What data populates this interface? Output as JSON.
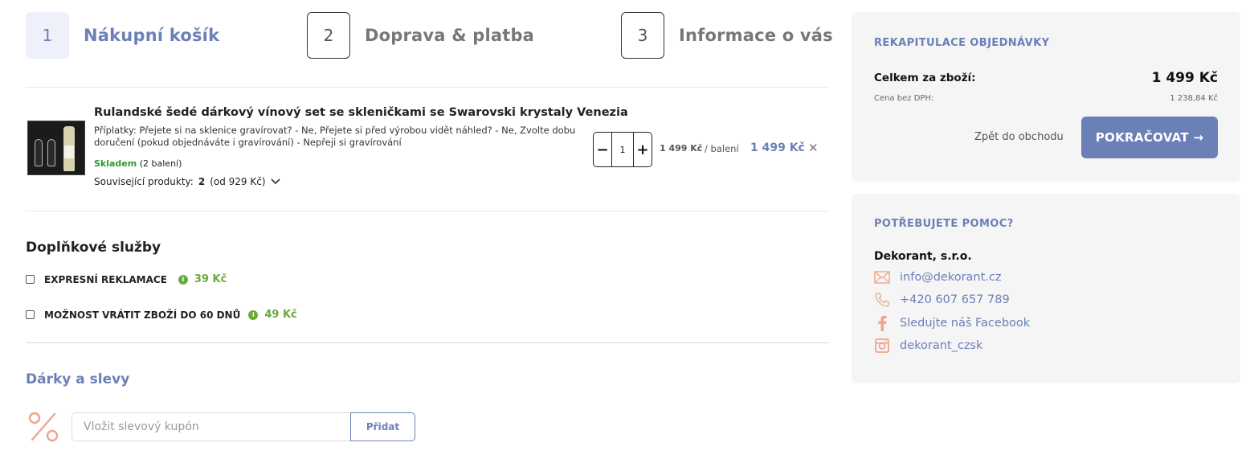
{
  "steps": [
    {
      "num": "1",
      "label": "Nákupní košík"
    },
    {
      "num": "2",
      "label": "Doprava & platba"
    },
    {
      "num": "3",
      "label": "Informace o vás"
    }
  ],
  "product": {
    "title": "Rulandské šedé dárkový vínový set se skleničkami se Swarovski krystaly Venezia",
    "extras": "Příplatky: Přejete si na sklenice gravírovat? - Ne, Přejete si před výrobou vidět náhled? - Ne, Zvolte dobu doručení (pokud objednáváte i gravírování) - Nepřeji si gravírování",
    "stock_status": "Skladem",
    "stock_detail": "(2 balení)",
    "related_label": "Související produkty:",
    "related_count": "2",
    "related_from": "(od 929 Kč)",
    "quantity": "1",
    "unit_price": "1 499 Kč",
    "per_unit": "/ balení",
    "total_price": "1 499 Kč"
  },
  "services": {
    "title": "Doplňkové služby",
    "items": [
      {
        "label": "EXPRESNÍ REKLAMACE",
        "price": "39 Kč"
      },
      {
        "label": "MOŽNOST VRÁTIT ZBOŽÍ DO 60 DNŮ",
        "price": "49 Kč"
      }
    ]
  },
  "gifts": {
    "title": "Dárky a slevy",
    "coupon_placeholder": "Vložit slevový kupón",
    "add_label": "Přidat"
  },
  "summary": {
    "title": "REKAPITULACE OBJEDNÁVKY",
    "total_label": "Celkem za zboží:",
    "total_value": "1 499 Kč",
    "net_label": "Cena bez DPH:",
    "net_value": "1 238,84 Kč",
    "back_label": "Zpět do obchodu",
    "continue_label": "POKRAČOVAT →"
  },
  "help": {
    "title": "POTŘEBUJETE POMOC?",
    "company": "Dekorant, s.r.o.",
    "email": "info@dekorant.cz",
    "phone": "+420 607 657 789",
    "facebook": "Sledujte náš Facebook",
    "instagram": "dekorant_czsk"
  },
  "colors": {
    "accent": "#6c80b8",
    "green": "#6aab3a",
    "icon_salmon": "#f0a48c"
  }
}
